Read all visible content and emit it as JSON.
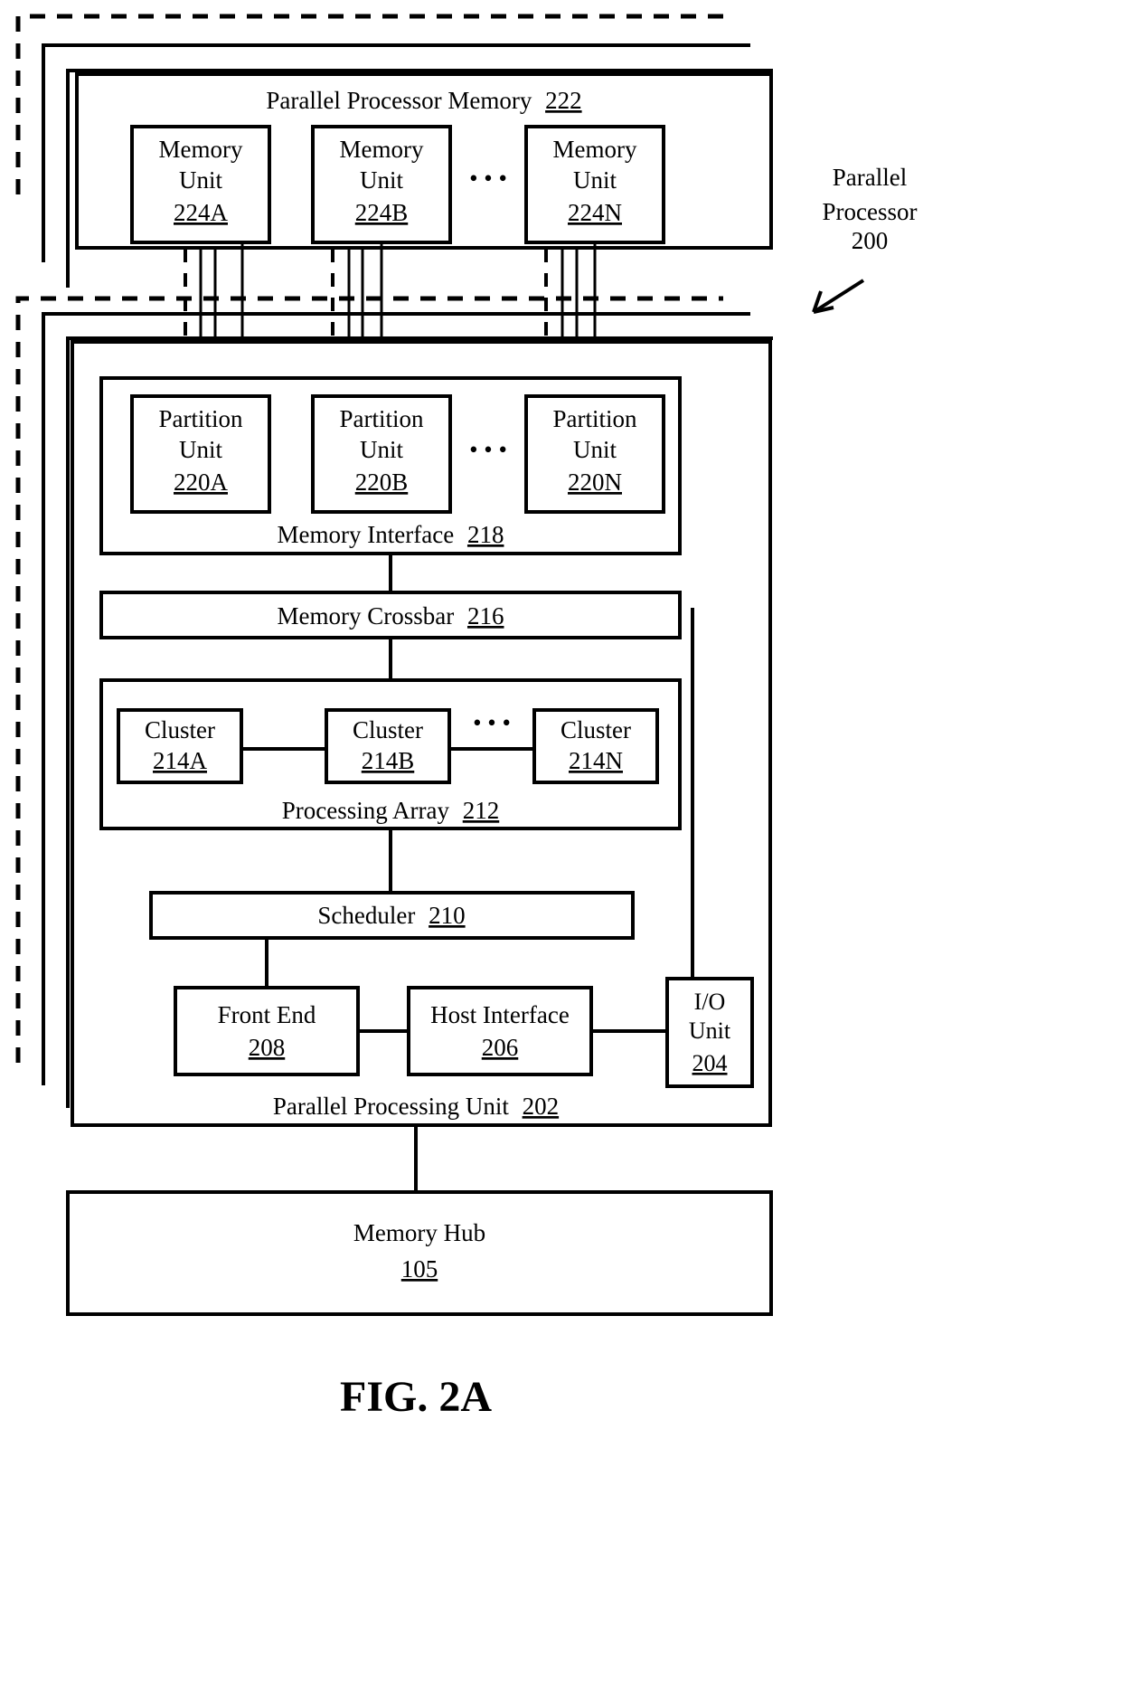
{
  "figure": {
    "caption": "FIG. 2A",
    "callout": {
      "line1": "Parallel",
      "line2": "Processor",
      "line3": "200"
    }
  },
  "memory_group": {
    "title_text": "Parallel Processor Memory",
    "title_num": "222",
    "units": [
      {
        "line1": "Memory",
        "line2": "Unit",
        "num": "224A"
      },
      {
        "line1": "Memory",
        "line2": "Unit",
        "num": "224B"
      },
      {
        "line1": "Memory",
        "line2": "Unit",
        "num": "224N"
      }
    ],
    "ellipsis": "• • •"
  },
  "processing_unit": {
    "title_text": "Parallel Processing Unit",
    "title_num": "202",
    "memory_interface": {
      "title_text": "Memory Interface",
      "title_num": "218",
      "partitions": [
        {
          "line1": "Partition",
          "line2": "Unit",
          "num": "220A"
        },
        {
          "line1": "Partition",
          "line2": "Unit",
          "num": "220B"
        },
        {
          "line1": "Partition",
          "line2": "Unit",
          "num": "220N"
        }
      ],
      "ellipsis": "• • •"
    },
    "memory_crossbar": {
      "title_text": "Memory Crossbar",
      "title_num": "216"
    },
    "processing_array": {
      "title_text": "Processing Array",
      "title_num": "212",
      "clusters": [
        {
          "line1": "Cluster",
          "num": "214A"
        },
        {
          "line1": "Cluster",
          "num": "214B"
        },
        {
          "line1": "Cluster",
          "num": "214N"
        }
      ],
      "ellipsis": "• • •"
    },
    "scheduler": {
      "title_text": "Scheduler",
      "title_num": "210"
    },
    "front_end": {
      "title_text": "Front End",
      "title_num": "208"
    },
    "host_interface": {
      "title_text": "Host Interface",
      "title_num": "206"
    },
    "io_unit": {
      "line1": "I/O",
      "line2": "Unit",
      "num": "204"
    }
  },
  "memory_hub": {
    "title_text": "Memory Hub",
    "title_num": "105"
  },
  "colors": {
    "ink": "#000000",
    "paper": "#ffffff"
  }
}
